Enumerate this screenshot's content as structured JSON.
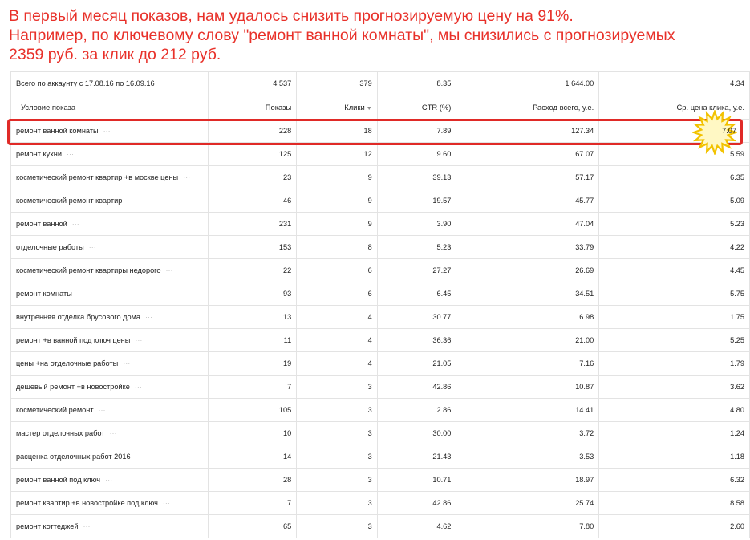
{
  "headline": {
    "line1": "В первый месяц показов, нам удалось снизить прогнозируемую цену на 91%.",
    "line2": "Например, по ключевому слову \"ремонт ванной комнаты\", мы снизились с прогнозируемых",
    "line3": "2359 руб. за клик до  212 руб."
  },
  "table": {
    "total": {
      "label": "Всего по аккаунту с 17.08.16 по 16.09.16",
      "impressions": "4 537",
      "clicks": "379",
      "ctr": "8.35",
      "cost": "1 644.00",
      "avg_cpc": "4.34"
    },
    "columns": {
      "condition": "Условие показа",
      "impressions": "Показы",
      "clicks": "Клики",
      "ctr": "CTR (%)",
      "cost": "Расход всего, у.е.",
      "avg_cpc": "Ср. цена клика, у.е."
    },
    "rows": [
      {
        "condition": "ремонт ванной комнаты",
        "impressions": "228",
        "clicks": "18",
        "ctr": "7.89",
        "cost": "127.34",
        "avg_cpc": ""
      },
      {
        "condition": "ремонт кухни",
        "impressions": "125",
        "clicks": "12",
        "ctr": "9.60",
        "cost": "67.07",
        "avg_cpc": "5.59"
      },
      {
        "condition": "косметический ремонт квартир +в москве цены",
        "impressions": "23",
        "clicks": "9",
        "ctr": "39.13",
        "cost": "57.17",
        "avg_cpc": "6.35"
      },
      {
        "condition": "косметический ремонт квартир",
        "impressions": "46",
        "clicks": "9",
        "ctr": "19.57",
        "cost": "45.77",
        "avg_cpc": "5.09"
      },
      {
        "condition": "ремонт ванной",
        "impressions": "231",
        "clicks": "9",
        "ctr": "3.90",
        "cost": "47.04",
        "avg_cpc": "5.23"
      },
      {
        "condition": "отделочные работы",
        "impressions": "153",
        "clicks": "8",
        "ctr": "5.23",
        "cost": "33.79",
        "avg_cpc": "4.22"
      },
      {
        "condition": "косметический ремонт квартиры недорого",
        "impressions": "22",
        "clicks": "6",
        "ctr": "27.27",
        "cost": "26.69",
        "avg_cpc": "4.45"
      },
      {
        "condition": "ремонт комнаты",
        "impressions": "93",
        "clicks": "6",
        "ctr": "6.45",
        "cost": "34.51",
        "avg_cpc": "5.75"
      },
      {
        "condition": "внутренняя отделка брусового дома",
        "impressions": "13",
        "clicks": "4",
        "ctr": "30.77",
        "cost": "6.98",
        "avg_cpc": "1.75"
      },
      {
        "condition": "ремонт +в ванной под ключ цены",
        "impressions": "11",
        "clicks": "4",
        "ctr": "36.36",
        "cost": "21.00",
        "avg_cpc": "5.25"
      },
      {
        "condition": "цены +на отделочные работы",
        "impressions": "19",
        "clicks": "4",
        "ctr": "21.05",
        "cost": "7.16",
        "avg_cpc": "1.79"
      },
      {
        "condition": "дешевый ремонт +в новостройке",
        "impressions": "7",
        "clicks": "3",
        "ctr": "42.86",
        "cost": "10.87",
        "avg_cpc": "3.62"
      },
      {
        "condition": "косметический ремонт",
        "impressions": "105",
        "clicks": "3",
        "ctr": "2.86",
        "cost": "14.41",
        "avg_cpc": "4.80"
      },
      {
        "condition": "мастер отделочных работ",
        "impressions": "10",
        "clicks": "3",
        "ctr": "30.00",
        "cost": "3.72",
        "avg_cpc": "1.24"
      },
      {
        "condition": "расценка отделочных работ 2016",
        "impressions": "14",
        "clicks": "3",
        "ctr": "21.43",
        "cost": "3.53",
        "avg_cpc": "1.18"
      },
      {
        "condition": "ремонт ванной под ключ",
        "impressions": "28",
        "clicks": "3",
        "ctr": "10.71",
        "cost": "18.97",
        "avg_cpc": "6.32"
      },
      {
        "condition": "ремонт квартир +в новостройке под ключ",
        "impressions": "7",
        "clicks": "3",
        "ctr": "42.86",
        "cost": "25.74",
        "avg_cpc": "8.58"
      },
      {
        "condition": "ремонт коттеджей",
        "impressions": "65",
        "clicks": "3",
        "ctr": "4.62",
        "cost": "7.80",
        "avg_cpc": "2.60"
      }
    ],
    "highlight_value": "7.07",
    "row_menu_glyph": "⋯",
    "sort_glyph": "▼"
  },
  "colors": {
    "headline": "#e8312a",
    "highlight_border": "#e02a27",
    "burst_fill": "#fff8c4",
    "burst_stroke": "#f2c200"
  },
  "icons": {
    "row_menu": "ellipsis-icon",
    "sort": "sort-desc-icon",
    "burst": "starburst-icon"
  }
}
